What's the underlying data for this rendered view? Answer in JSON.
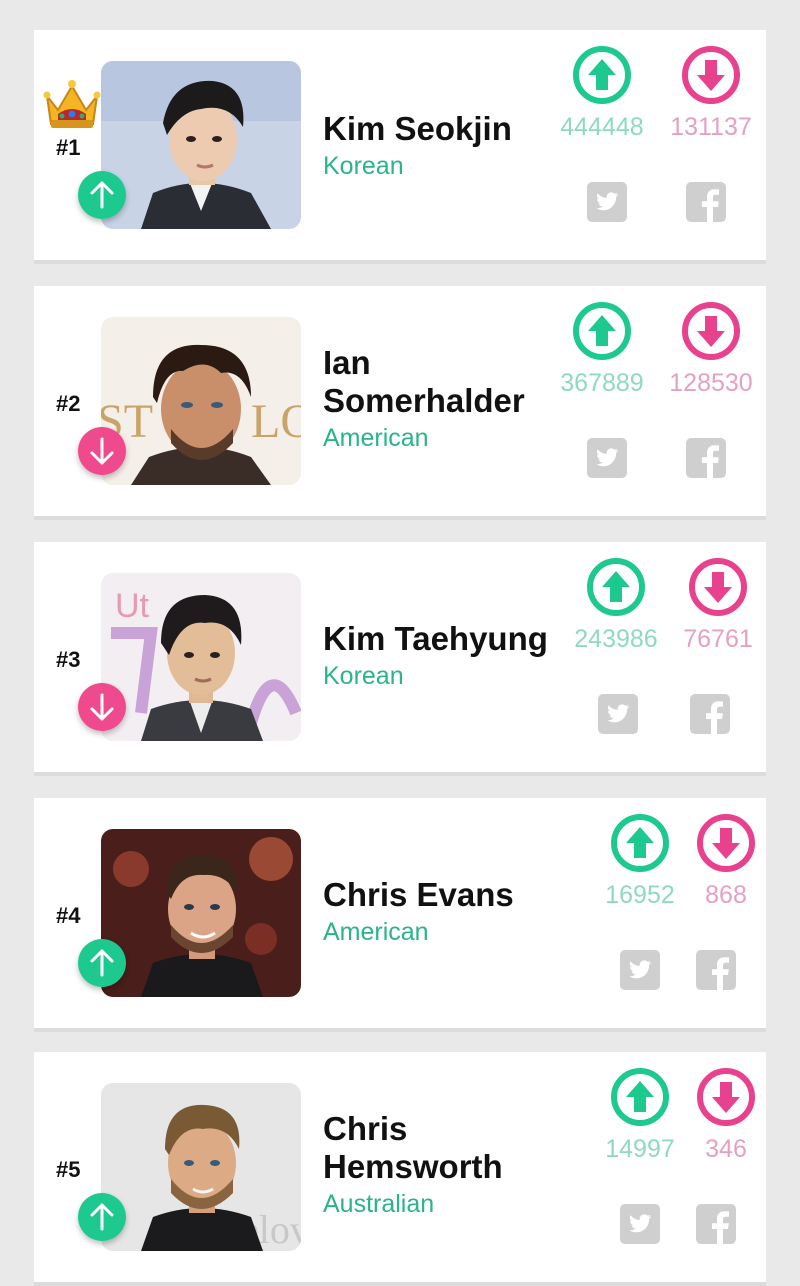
{
  "colors": {
    "upvote": "#1ec98f",
    "downvote": "#e8418d",
    "up_count": "#8fd9c2",
    "down_count": "#e4a1c3",
    "nationality": "#2bb38a",
    "share_icon": "#cfcfcf",
    "background": "#e9e9e9"
  },
  "icons": {
    "upvote": "upvote-icon",
    "downvote": "downvote-icon",
    "twitter": "twitter-icon",
    "facebook": "facebook-icon",
    "crown": "crown-icon",
    "trend_up": "trend-up-icon",
    "trend_down": "trend-down-icon"
  },
  "entries": [
    {
      "rank": "#1",
      "name": "Kim Seokjin",
      "nationality": "Korean",
      "upvotes": "444448",
      "downvotes": "131137",
      "trend": "up",
      "crown": true
    },
    {
      "rank": "#2",
      "name": "Ian Somerhalder",
      "nationality": "American",
      "upvotes": "367889",
      "downvotes": "128530",
      "trend": "down",
      "crown": false
    },
    {
      "rank": "#3",
      "name": "Kim Taehyung",
      "nationality": "Korean",
      "upvotes": "243986",
      "downvotes": "76761",
      "trend": "down",
      "crown": false
    },
    {
      "rank": "#4",
      "name": "Chris Evans",
      "nationality": "American",
      "upvotes": "16952",
      "downvotes": "868",
      "trend": "up",
      "crown": false
    },
    {
      "rank": "#5",
      "name": "Chris Hemsworth",
      "nationality": "Australian",
      "upvotes": "14997",
      "downvotes": "346",
      "trend": "up",
      "crown": false
    }
  ]
}
